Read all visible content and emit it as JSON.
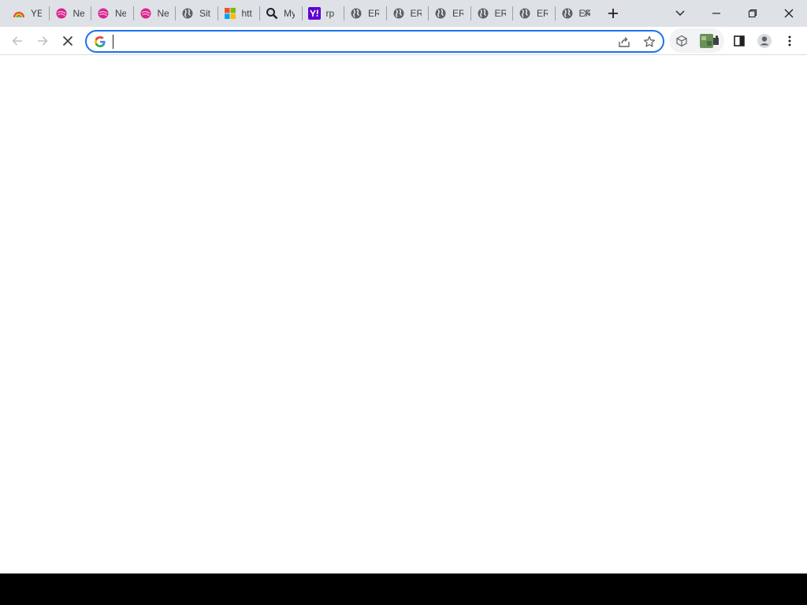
{
  "browser": {
    "tabs": [
      {
        "label": "YE",
        "icon": "rainbow-icon"
      },
      {
        "label": "Ne",
        "icon": "pink-orb-icon"
      },
      {
        "label": "Ne",
        "icon": "pink-orb-icon"
      },
      {
        "label": "Ne",
        "icon": "pink-orb-icon"
      },
      {
        "label": "Sit",
        "icon": "globe-icon"
      },
      {
        "label": "htt",
        "icon": "microsoft-logo-icon"
      },
      {
        "label": "My",
        "icon": "magnifier-icon"
      },
      {
        "label": "rp",
        "icon": "yahoo-logo-icon"
      },
      {
        "label": "ER",
        "icon": "globe-icon"
      },
      {
        "label": "ER",
        "icon": "globe-icon"
      },
      {
        "label": "ER",
        "icon": "globe-icon"
      },
      {
        "label": "ER",
        "icon": "globe-icon"
      },
      {
        "label": "ER",
        "icon": "globe-icon"
      },
      {
        "label": "ER",
        "icon": "globe-icon"
      }
    ],
    "address_bar": {
      "value": ""
    },
    "colors": {
      "tabstrip": "#dee1e6",
      "omnibox_focus": "#1a73e8",
      "icon": "#5f6368"
    }
  }
}
